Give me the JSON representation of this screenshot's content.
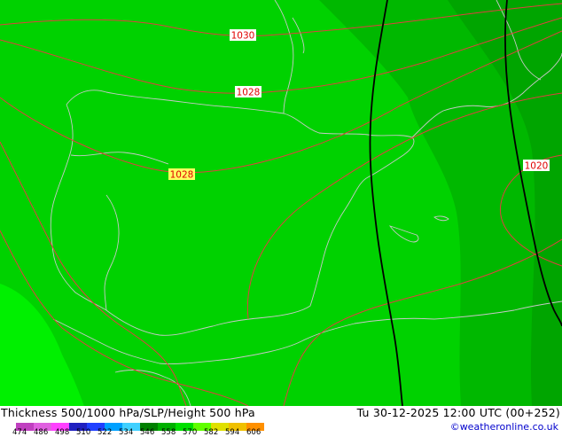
{
  "map": {
    "isobars": [
      {
        "label": "1030"
      },
      {
        "label": "1028"
      },
      {
        "label": "1028"
      },
      {
        "label": "1020"
      }
    ],
    "colors": {
      "thickness_main": "#00d200",
      "thickness_dark": "#00ad00",
      "thickness_darker": "#009600",
      "thickness_light": "#00f000",
      "isobar": "#e04040",
      "contour_500": "#000000",
      "coastline": "#c8c8c8"
    }
  },
  "footer": {
    "title_left": "Thickness 500/1000 hPa/SLP/Height 500 hPa",
    "title_right": "Tu 30-12-2025 12:00 UTC (00+252)",
    "credit": "©weatheronline.co.uk",
    "scale": {
      "ticks": [
        "474",
        "486",
        "498",
        "510",
        "522",
        "534",
        "546",
        "558",
        "570",
        "582",
        "594",
        "606"
      ],
      "colors": [
        "#c040c0",
        "#e060e0",
        "#ff40ff",
        "#2020c0",
        "#2040ff",
        "#00a0ff",
        "#40d0ff",
        "#008000",
        "#00b000",
        "#00e000",
        "#60ff00",
        "#e0e000",
        "#f0c000",
        "#ff9000"
      ]
    }
  }
}
